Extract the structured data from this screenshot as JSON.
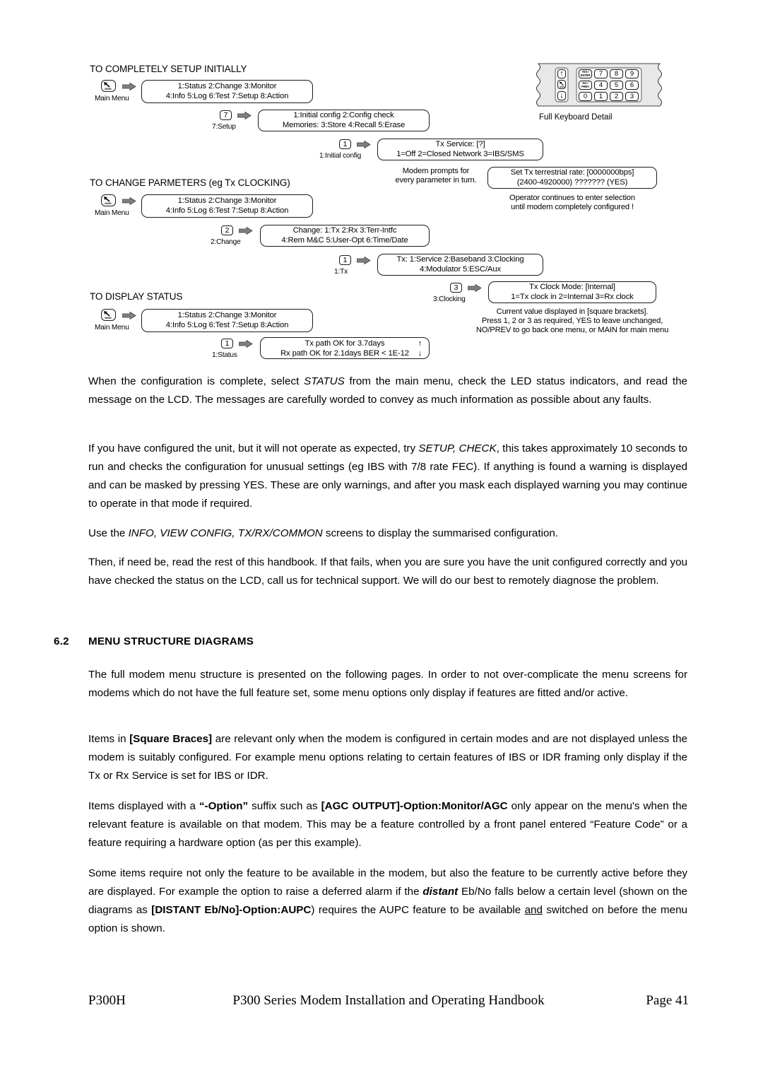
{
  "diagrams": {
    "section1": {
      "heading": "TO COMPLETELY SETUP INITIALLY",
      "main_menu_label": "Main Menu",
      "main_menu_box": {
        "line1": "1:Status  2:Change  3:Monitor",
        "line2": "4:Info  5:Log  6:Test  7:Setup  8:Action"
      },
      "step_setup": {
        "key": "7",
        "key_label": "7:Setup",
        "box_line1": "1:Initial config  2:Config check",
        "box_line2": "Memories: 3:Store  4:Recall  5:Erase"
      },
      "step_initial": {
        "key": "1",
        "key_label": "1:Initial config",
        "box_line1": "Tx Service: [?]",
        "box_line2": "1=Off  2=Closed Network  3=IBS/SMS"
      },
      "note_prompts_line1": "Modem prompts for",
      "note_prompts_line2": "every parameter in turn.",
      "rate_box_line1": "Set Tx terrestrial rate: [0000000bps]",
      "rate_box_line2": "(2400-4920000) ??????? (YES)",
      "note_operator_line1": "Operator continues to enter selection",
      "note_operator_line2": "until modem completely configured !"
    },
    "section2": {
      "heading": "TO CHANGE PARMETERS (eg Tx CLOCKING)",
      "main_menu_label": "Main Menu",
      "main_menu_box": {
        "line1": "1:Status  2:Change  3:Monitor",
        "line2": "4:Info  5:Log  6:Test  7:Setup  8:Action"
      },
      "step_change": {
        "key": "2",
        "key_label": "2:Change",
        "box_line1": "Change: 1:Tx  2:Rx  3:Terr-Intfc",
        "box_line2": "4:Rem M&C  5:User-Opt  6:Time/Date"
      },
      "step_tx": {
        "key": "1",
        "key_label": "1:Tx",
        "box_line1": "Tx: 1:Service  2:Baseband  3:Clocking",
        "box_line2": "4:Modulator  5:ESC/Aux"
      },
      "step_clocking": {
        "key": "3",
        "key_label": "3:Clocking",
        "box_line1": "Tx Clock Mode: [Internal]",
        "box_line2": "1=Tx clock in  2=Internal  3=Rx clock"
      },
      "note_line1": "Current value displayed in [square brackets].",
      "note_line2": "Press 1, 2 or 3 as required, YES to leave unchanged,",
      "note_line3": "NO/PREV to go back one menu, or MAIN for main menu"
    },
    "section3": {
      "heading": "TO DISPLAY STATUS",
      "main_menu_label": "Main Menu",
      "main_menu_box": {
        "line1": "1:Status  2:Change  3:Monitor",
        "line2": "4:Info  5:Log  6:Test  7:Setup  8:Action"
      },
      "step_status": {
        "key": "1",
        "key_label": "1:Status",
        "box_line1": "Tx path OK for 3.7days",
        "box_line2": "Rx path OK for 2.1days  BER < 1E-12",
        "arrow_up": "↑",
        "arrow_down": "↓"
      }
    },
    "keyboard": {
      "caption": "Full Keyboard Detail",
      "left_column": [
        "↑",
        "MAIN",
        "↓"
      ],
      "keys": [
        [
          "YES / ENTER",
          "7",
          "8",
          "9"
        ],
        [
          "NO / PREV",
          "4",
          "5",
          "6"
        ],
        [
          "0",
          "1",
          "2",
          "3"
        ]
      ],
      "yes_line1": "YES /",
      "yes_line2": "ENTER",
      "no_line1": "NO /",
      "no_line2": "PREV",
      "main_text": "MAIN"
    }
  },
  "body": {
    "p1": "When the configuration is complete, select <i>STATUS</i> from the main menu, check the LED status indicators, and read the message on the LCD. The messages are carefully worded to convey as much information as possible about any faults.",
    "p2": "If you have configured the unit, but it will not operate as expected, try <i>SETUP, CHECK</i>, this takes approximately 10 seconds to run and checks the configuration for unusual settings (eg IBS with 7/8 rate FEC). If anything is found a warning is displayed and can be masked by pressing YES. These are only warnings, and after you mask each displayed warning you may continue to operate in that mode if required.",
    "p3": "Use the <i>INFO, VIEW CONFIG, TX/RX/COMMON</i> screens to display the summarised configuration.",
    "p4": "Then, if need be, read the rest of this handbook. If that fails, when you are sure you have the unit configured correctly and you have checked the status on the LCD, call us for technical support. We will do our best to remotely diagnose the problem.",
    "section_number": "6.2",
    "section_title": "MENU STRUCTURE DIAGRAMS",
    "p5": "The full modem menu structure is presented on the following pages. In order to not over-complicate the menu screens for modems which do not have the full feature set, some menu options only display if features are fitted and/or active.",
    "p6": "Items in <b>[Square Braces]</b> are relevant only when the modem is configured in certain modes and are not displayed unless the modem is suitably configured. For example menu options relating to certain features of IBS or IDR framing only display if the Tx or Rx Service is set for IBS or IDR.",
    "p7": "Items displayed with a <b>“-Option”</b> suffix such as <b>[AGC OUTPUT]-Option:Monitor/AGC</b> only appear on the menu's when the relevant feature is available on that modem. This may be a feature controlled by a front panel entered “Feature Code” or a feature requiring a hardware option (as per this example).",
    "p8": "Some items require not only the feature to be available in the modem, but also the feature to be currently active before they are displayed. For example the option to raise a deferred alarm if the <b><i>distant</i></b> Eb/No falls below a certain level (shown on the diagrams as <b>[DISTANT Eb/No]-Option:AUPC</b>) requires the AUPC feature to be available <u>and</u> switched on before the menu option is shown."
  },
  "footer": {
    "left": "P300H",
    "center": "P300 Series Modem Installation and Operating Handbook",
    "right": "Page 41"
  }
}
